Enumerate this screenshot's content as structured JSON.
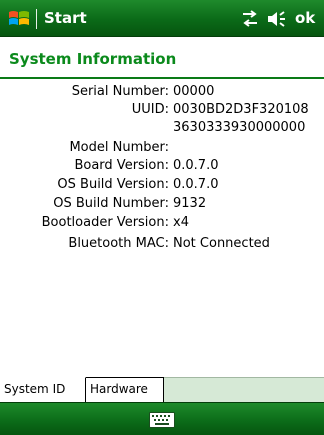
{
  "taskbar": {
    "start_label": "Start",
    "ok_label": "ok",
    "icons": [
      "windows-flag-icon",
      "connectivity-icon",
      "volume-icon"
    ]
  },
  "page": {
    "title": "System Information"
  },
  "info": {
    "serial_number_label": "Serial Number:",
    "serial_number_value": "00000",
    "uuid_label": "UUID:",
    "uuid_value_line1": "0030BD2D3F320108",
    "uuid_value_line2": "3630333930000000",
    "model_number_label": "Model Number:",
    "model_number_value": "",
    "board_version_label": "Board Version:",
    "board_version_value": "0.0.7.0",
    "os_build_version_label": "OS Build Version:",
    "os_build_version_value": "0.0.7.0",
    "os_build_number_label": "OS Build Number:",
    "os_build_number_value": "9132",
    "bootloader_version_label": "Bootloader Version:",
    "bootloader_version_value": "x4",
    "bluetooth_mac_label": "Bluetooth MAC:",
    "bluetooth_mac_value": "Not Connected"
  },
  "tabs": {
    "system_id": "System ID",
    "hardware": "Hardware",
    "active": "System ID"
  },
  "menu_bar": {
    "icons": [
      "keyboard-icon"
    ]
  },
  "colors": {
    "bar_green": "#0b6a18",
    "title_green": "#0b8a1c",
    "tab_strip": "#d6e9d6"
  }
}
